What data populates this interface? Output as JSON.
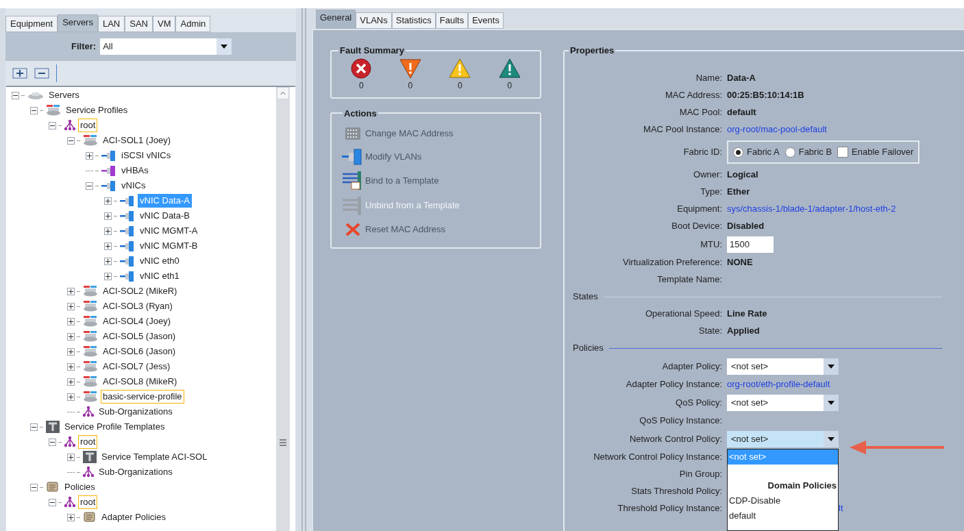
{
  "left_tabs": [
    {
      "label": "Equipment",
      "selected": false
    },
    {
      "label": "Servers",
      "selected": true
    },
    {
      "label": "LAN",
      "selected": false
    },
    {
      "label": "SAN",
      "selected": false
    },
    {
      "label": "VM",
      "selected": false
    },
    {
      "label": "Admin",
      "selected": false
    }
  ],
  "filter": {
    "label": "Filter:",
    "value": "All"
  },
  "tree": [
    {
      "label": "Servers",
      "kind": "servers",
      "expanded": true,
      "selected": false,
      "highlighted": false,
      "children": [
        {
          "label": "Service Profiles",
          "kind": "profile",
          "expanded": true,
          "selected": false,
          "highlighted": false,
          "children": [
            {
              "label": "root",
              "kind": "org",
              "expanded": true,
              "selected": false,
              "highlighted": true,
              "children": [
                {
                  "label": "ACI-SOL1 (Joey)",
                  "kind": "profile",
                  "expanded": true,
                  "selected": false,
                  "highlighted": false,
                  "children": [
                    {
                      "label": "iSCSI vNICs",
                      "kind": "vnic",
                      "expanded": false,
                      "selected": false,
                      "highlighted": false
                    },
                    {
                      "label": "vHBAs",
                      "kind": "vhba",
                      "selected": false,
                      "highlighted": false
                    },
                    {
                      "label": "vNICs",
                      "kind": "vnic",
                      "expanded": true,
                      "selected": false,
                      "highlighted": false,
                      "children": [
                        {
                          "label": "vNIC Data-A",
                          "kind": "vnic",
                          "expanded": false,
                          "selected": true,
                          "highlighted": false
                        },
                        {
                          "label": "vNIC Data-B",
                          "kind": "vnic",
                          "expanded": false,
                          "selected": false,
                          "highlighted": false
                        },
                        {
                          "label": "vNIC MGMT-A",
                          "kind": "vnic",
                          "expanded": false,
                          "selected": false,
                          "highlighted": false
                        },
                        {
                          "label": "vNIC MGMT-B",
                          "kind": "vnic",
                          "expanded": false,
                          "selected": false,
                          "highlighted": false
                        },
                        {
                          "label": "vNIC eth0",
                          "kind": "vnic",
                          "expanded": false,
                          "selected": false,
                          "highlighted": false
                        },
                        {
                          "label": "vNIC eth1",
                          "kind": "vnic",
                          "expanded": false,
                          "selected": false,
                          "highlighted": false
                        }
                      ]
                    }
                  ]
                },
                {
                  "label": "ACI-SOL2 (MikeR)",
                  "kind": "profile",
                  "expanded": false,
                  "selected": false,
                  "highlighted": false
                },
                {
                  "label": "ACI-SOL3 (Ryan)",
                  "kind": "profile",
                  "expanded": false,
                  "selected": false,
                  "highlighted": false
                },
                {
                  "label": "ACI-SOL4 (Joey)",
                  "kind": "profile",
                  "expanded": false,
                  "selected": false,
                  "highlighted": false
                },
                {
                  "label": "ACI-SOL5 (Jason)",
                  "kind": "profile",
                  "expanded": false,
                  "selected": false,
                  "highlighted": false
                },
                {
                  "label": "ACI-SOL6 (Jason)",
                  "kind": "profile",
                  "expanded": false,
                  "selected": false,
                  "highlighted": false
                },
                {
                  "label": "ACI-SOL7 (Jess)",
                  "kind": "profile",
                  "expanded": false,
                  "selected": false,
                  "highlighted": false
                },
                {
                  "label": "ACI-SOL8 (MikeR)",
                  "kind": "profile",
                  "expanded": false,
                  "selected": false,
                  "highlighted": false
                },
                {
                  "label": "basic-service-profile",
                  "kind": "profile",
                  "expanded": false,
                  "selected": false,
                  "highlighted": true
                },
                {
                  "label": "Sub-Organizations",
                  "kind": "org",
                  "selected": false,
                  "highlighted": false
                }
              ]
            }
          ]
        },
        {
          "label": "Service Profile Templates",
          "kind": "template",
          "expanded": true,
          "selected": false,
          "highlighted": false,
          "children": [
            {
              "label": "root",
              "kind": "org",
              "expanded": true,
              "selected": false,
              "highlighted": true,
              "children": [
                {
                  "label": "Service Template ACI-SOL",
                  "kind": "template",
                  "expanded": false,
                  "selected": false,
                  "highlighted": false
                },
                {
                  "label": "Sub-Organizations",
                  "kind": "org",
                  "selected": false,
                  "highlighted": false
                }
              ]
            }
          ]
        },
        {
          "label": "Policies",
          "kind": "policy",
          "expanded": true,
          "selected": false,
          "highlighted": false,
          "children": [
            {
              "label": "root",
              "kind": "org",
              "expanded": true,
              "selected": false,
              "highlighted": true,
              "children": [
                {
                  "label": "Adapter Policies",
                  "kind": "policy",
                  "expanded": false,
                  "selected": false,
                  "highlighted": false
                }
              ]
            }
          ]
        }
      ]
    }
  ],
  "right_tabs": [
    {
      "label": "General",
      "selected": true
    },
    {
      "label": "VLANs",
      "selected": false
    },
    {
      "label": "Statistics",
      "selected": false
    },
    {
      "label": "Faults",
      "selected": false
    },
    {
      "label": "Events",
      "selected": false
    }
  ],
  "fault_summary": {
    "title": "Fault Summary",
    "faults": [
      {
        "kind": "critical",
        "count": "0"
      },
      {
        "kind": "major",
        "count": "0"
      },
      {
        "kind": "minor",
        "count": "0"
      },
      {
        "kind": "warning",
        "count": "0"
      }
    ]
  },
  "actions": {
    "title": "Actions",
    "items": [
      {
        "kind": "mac",
        "label": "Change MAC Address",
        "disabled": false
      },
      {
        "kind": "vlan",
        "label": "Modify VLANs",
        "disabled": false
      },
      {
        "kind": "bind",
        "label": "Bind to a Template",
        "disabled": false
      },
      {
        "kind": "unbind",
        "label": "Unbind from a Template",
        "disabled": true
      },
      {
        "kind": "reset",
        "label": "Reset MAC Address",
        "disabled": false
      }
    ]
  },
  "properties": {
    "title": "Properties",
    "rows": [
      {
        "kind": "text",
        "label": "Name:",
        "value": "Data-A"
      },
      {
        "kind": "text",
        "label": "MAC Address:",
        "value": "00:25:B5:10:14:1B"
      },
      {
        "kind": "text",
        "label": "MAC Pool:",
        "value": "default"
      },
      {
        "kind": "link",
        "label": "MAC Pool Instance:",
        "value": "org-root/mac-pool-default"
      },
      {
        "kind": "radio",
        "label": "Fabric ID:",
        "options": [
          {
            "label": "Fabric A",
            "selected": true
          },
          {
            "label": "Fabric B",
            "selected": false
          }
        ],
        "checkbox": {
          "label": "Enable Failover",
          "checked": false
        }
      },
      {
        "kind": "text",
        "label": "Owner:",
        "value": "Logical"
      },
      {
        "kind": "text",
        "label": "Type:",
        "value": "Ether"
      },
      {
        "kind": "link",
        "label": "Equipment:",
        "value": "sys/chassis-1/blade-1/adapter-1/host-eth-2"
      },
      {
        "kind": "text",
        "label": "Boot Device:",
        "value": "Disabled"
      },
      {
        "kind": "input",
        "label": "MTU:",
        "value": "1500"
      },
      {
        "kind": "text",
        "label": "Virtualization Preference:",
        "value": "NONE"
      },
      {
        "kind": "empty",
        "label": "Template Name:"
      },
      {
        "kind": "section",
        "label": "States"
      },
      {
        "kind": "text",
        "label": "Operational Speed:",
        "value": "Line Rate"
      },
      {
        "kind": "text",
        "label": "State:",
        "value": "Applied"
      },
      {
        "kind": "section",
        "label": "Policies"
      },
      {
        "kind": "select",
        "label": "Adapter Policy:",
        "value": "<not set>",
        "open": false
      },
      {
        "kind": "link",
        "label": "Adapter Policy Instance:",
        "value": "org-root/eth-profile-default"
      },
      {
        "kind": "select",
        "label": "QoS Policy:",
        "value": "<not set>",
        "open": false
      },
      {
        "kind": "empty",
        "label": "QoS Policy Instance:"
      },
      {
        "kind": "select",
        "label": "Network Control Policy:",
        "value": "<not set>",
        "open": true,
        "options": [
          {
            "kind": "option",
            "text": "<not set>",
            "selected": true
          },
          {
            "kind": "header",
            "text": "Domain Policies"
          },
          {
            "kind": "option",
            "text": "CDP-Disable",
            "selected": false
          },
          {
            "kind": "option",
            "text": "default",
            "selected": false
          }
        ]
      },
      {
        "kind": "empty",
        "label": "Network Control Policy Instance:"
      },
      {
        "kind": "empty",
        "label": "Pin Group:"
      },
      {
        "kind": "empty",
        "label": "Stats Threshold Policy:"
      },
      {
        "kind": "covered_link",
        "label": "Threshold Policy Instance:",
        "value": "lt"
      }
    ]
  }
}
